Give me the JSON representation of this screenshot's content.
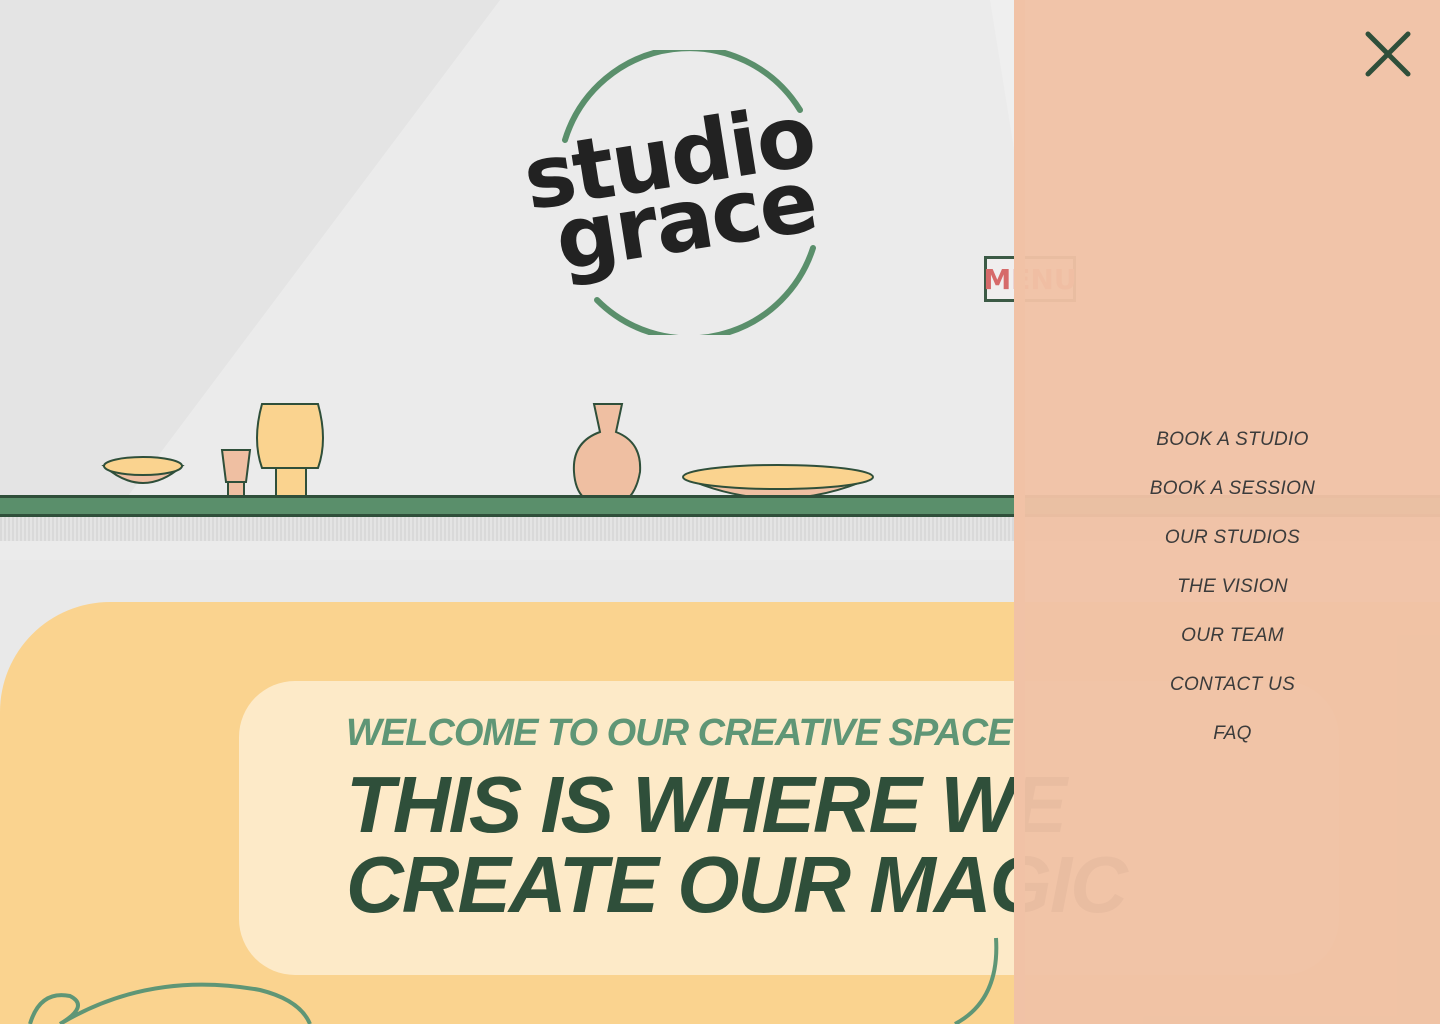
{
  "colors": {
    "wall": "#ebebeb",
    "shelf_green": "#5a8f6b",
    "dark_green": "#2f4f3a",
    "hero_yellow": "#fad38f",
    "card_cream": "#fdeac8",
    "kicker_green": "#5f9676",
    "panel_peach": "#f0c2a6",
    "vase_peach": "#efbfa2",
    "lamp_yellow": "#fad38f"
  },
  "logo": {
    "line1": "studio",
    "line2": "grace"
  },
  "menu_sign": {
    "label": "MENU"
  },
  "hero": {
    "kicker": "WELCOME TO OUR CREATIVE SPACE",
    "title_line1": "THIS IS WHERE WE",
    "title_line2": "CREATE OUR MAGIC"
  },
  "overlay": {
    "close_icon": "close-x-icon",
    "nav": [
      {
        "label": "BOOK A STUDIO"
      },
      {
        "label": "BOOK A SESSION"
      },
      {
        "label": "OUR STUDIOS"
      },
      {
        "label": "THE VISION"
      },
      {
        "label": "OUR TEAM"
      },
      {
        "label": "CONTACT US"
      },
      {
        "label": "FAQ"
      }
    ]
  }
}
